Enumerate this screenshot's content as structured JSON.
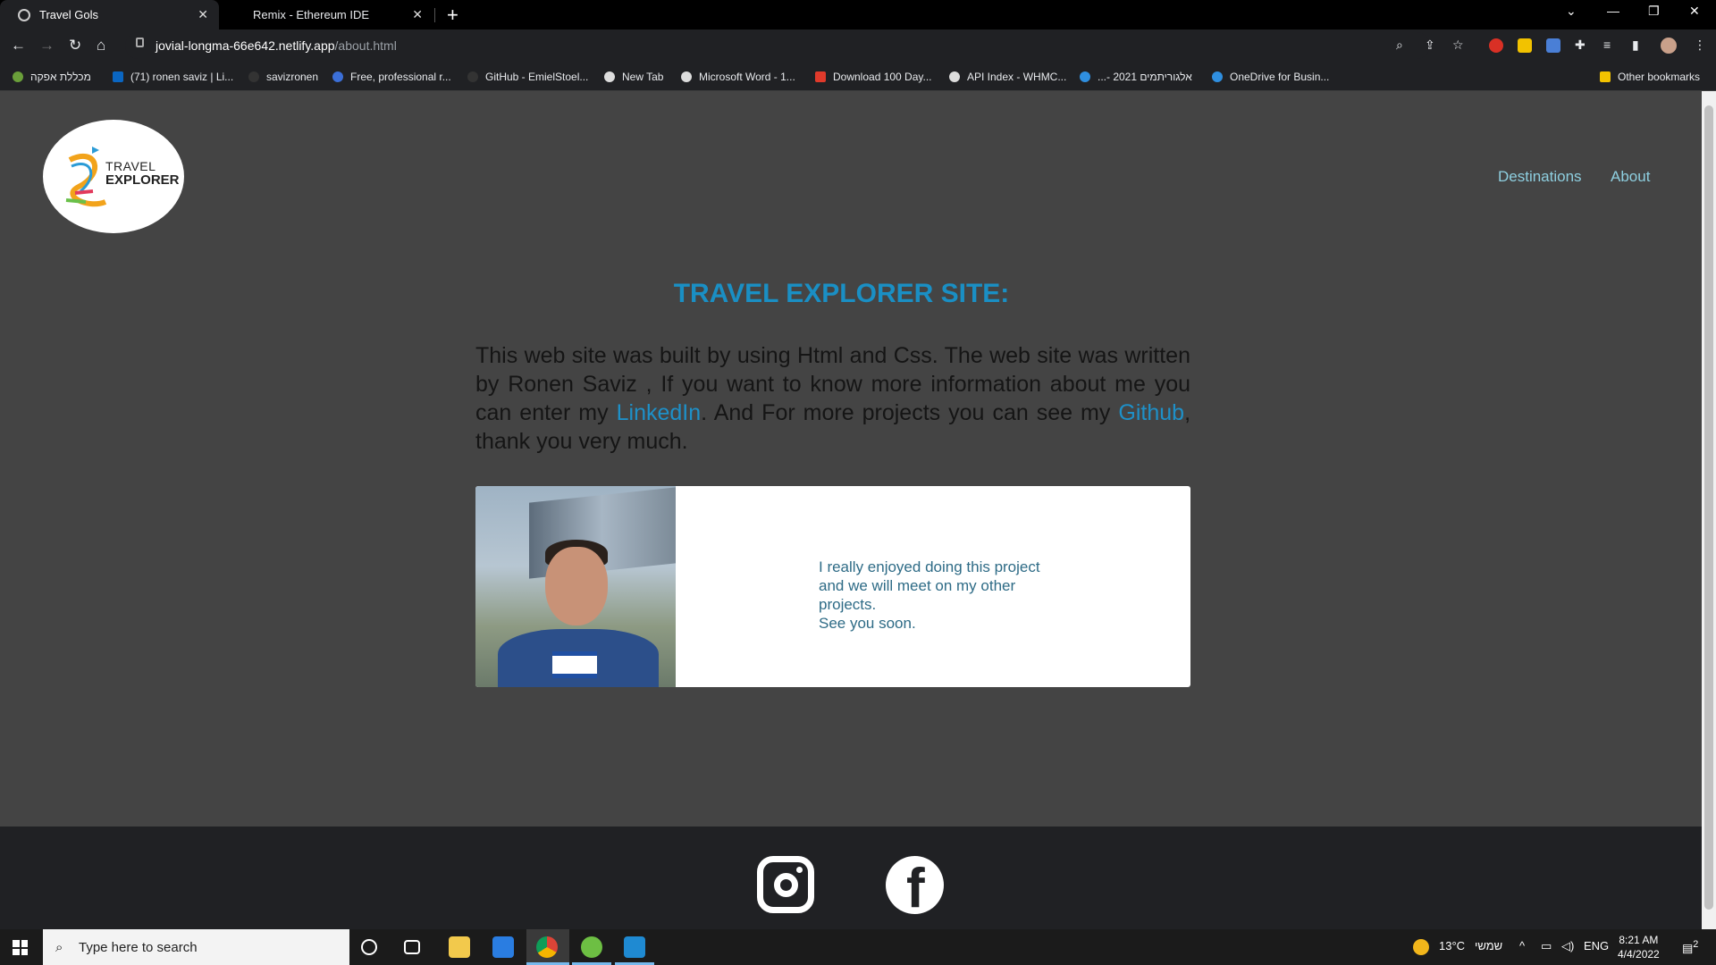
{
  "browser": {
    "tabs": [
      {
        "title": "Travel Gols"
      },
      {
        "title": "Remix - Ethereum IDE"
      }
    ],
    "url_host": "jovial-longma-66e642.netlify.app",
    "url_path": "/about.html",
    "bookmarks": [
      "מכללת אפקה",
      "(71) ronen saviz | Li...",
      "savizronen",
      "Free, professional r...",
      "GitHub - EmielStoel...",
      "New Tab",
      "Microsoft Word - 1...",
      "Download 100 Day...",
      "API Index - WHMC...",
      "...- 2021 אלגוריתמים",
      "OneDrive for Busin...",
      "Other bookmarks"
    ]
  },
  "site": {
    "logo": {
      "line1": "TRAVEL",
      "line2": "EXPLORER"
    },
    "nav": [
      {
        "label": "Destinations"
      },
      {
        "label": "About"
      }
    ],
    "title": "TRAVEL EXPLORER SITE:",
    "intro": {
      "part1": "This web site was built by using Html and Css. The web site was written by Ronen Saviz , If you want to know more information about me you can enter my ",
      "link1": "LinkedIn",
      "part2": ". And For more projects you can see my ",
      "link2": "Github",
      "part3": ", thank you very much."
    },
    "card_text": [
      "I really enjoyed doing this project",
      "and we will meet on my other",
      "projects.",
      "See you soon."
    ],
    "footer_icons": [
      "instagram-icon",
      "facebook-icon"
    ]
  },
  "taskbar": {
    "search_placeholder": "Type here to search",
    "weather": "13°C",
    "weather_day": "שמשי",
    "language": "ENG",
    "time": "8:21 AM",
    "date": "4/4/2022",
    "notifications": "2"
  },
  "colors": {
    "page_bg": "#444444",
    "accent_blue": "#1a8fc4",
    "nav_text": "#8ecfe0",
    "footer_bg": "#202124"
  }
}
